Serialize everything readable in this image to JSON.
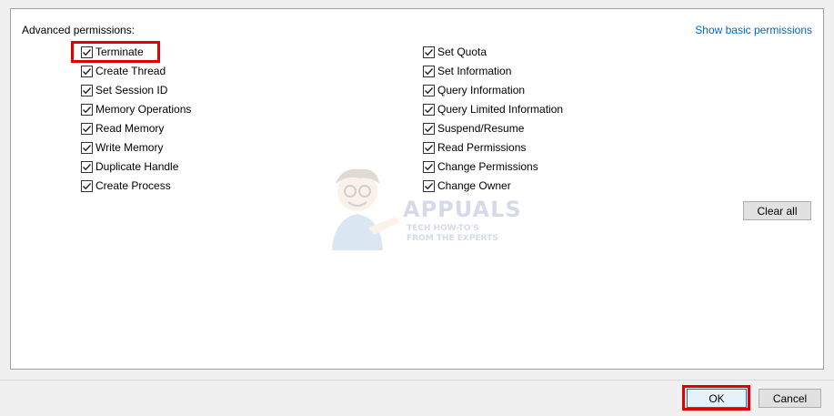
{
  "advanced_title": "Advanced permissions:",
  "show_basic_link": "Show basic permissions",
  "left_permissions": [
    {
      "label": "Terminate",
      "checked": true
    },
    {
      "label": "Create Thread",
      "checked": true
    },
    {
      "label": "Set Session ID",
      "checked": true
    },
    {
      "label": "Memory Operations",
      "checked": true
    },
    {
      "label": "Read Memory",
      "checked": true
    },
    {
      "label": "Write Memory",
      "checked": true
    },
    {
      "label": "Duplicate Handle",
      "checked": true
    },
    {
      "label": "Create Process",
      "checked": true
    }
  ],
  "right_permissions": [
    {
      "label": "Set Quota",
      "checked": true
    },
    {
      "label": "Set Information",
      "checked": true
    },
    {
      "label": "Query Information",
      "checked": true
    },
    {
      "label": "Query Limited Information",
      "checked": true
    },
    {
      "label": "Suspend/Resume",
      "checked": true
    },
    {
      "label": "Read Permissions",
      "checked": true
    },
    {
      "label": "Change Permissions",
      "checked": true
    },
    {
      "label": "Change Owner",
      "checked": true
    }
  ],
  "buttons": {
    "clear_all": "Clear all",
    "ok": "OK",
    "cancel": "Cancel"
  },
  "watermark": {
    "brand": "APPUALS",
    "tagline": "TECH HOW-TO'S FROM THE EXPERTS"
  },
  "colors": {
    "link": "#0066cc",
    "highlight": "#e00000",
    "ok_border": "#0078d7"
  }
}
